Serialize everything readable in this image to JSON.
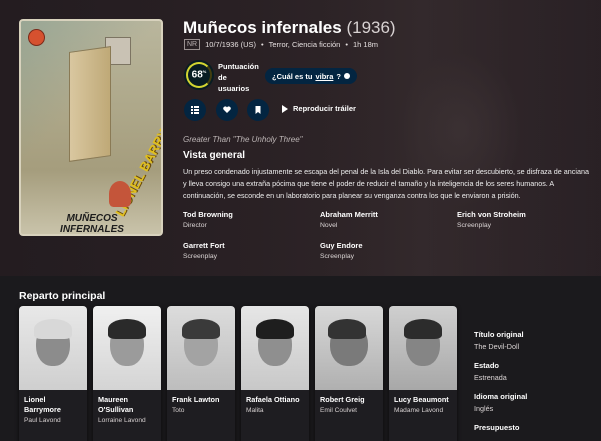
{
  "movie": {
    "title": "Muñecos infernales",
    "year": "(1936)",
    "certification": "NR",
    "release": "10/7/1936 (US)",
    "genres": "Terror, Ciencia ficción",
    "runtime": "1h 18m",
    "dot": "•"
  },
  "poster": {
    "actor_first": "LIONEL",
    "actor_last": "BARRYMORE",
    "caption_line1": "MUÑECOS",
    "caption_line2": "INFERNALES"
  },
  "score": {
    "value": "68",
    "unit": "%",
    "percent": 68,
    "label_line1": "Puntuación",
    "label_line2": "de",
    "label_line3": "usuarios",
    "ring_color": "#d2d531"
  },
  "vibe": {
    "prefix": "¿Cuál es tu ",
    "link": "vibra",
    "suffix": "?"
  },
  "actions": {
    "list_icon": "list-icon",
    "favorite_icon": "heart-icon",
    "watchlist_icon": "bookmark-icon",
    "play_label": "Reproducir tráiler"
  },
  "tagline": "Greater Than \"The Unholy Three\"",
  "overview": {
    "heading": "Vista general",
    "text": "Un preso condenado injustamente se escapa del penal de la Isla del Diablo. Para evitar ser descubierto, se disfraza de anciana y lleva consigo una extraña pócima que tiene el poder de reducir el tamaño y la inteligencia de los seres humanos. A continuación, se esconde en un laboratorio para planear su venganza contra los que le enviaron a prisión."
  },
  "crew": [
    {
      "name": "Tod Browning",
      "role": "Director"
    },
    {
      "name": "Abraham Merritt",
      "role": "Novel"
    },
    {
      "name": "Erich von Stroheim",
      "role": "Screenplay"
    },
    {
      "name": "Garrett Fort",
      "role": "Screenplay"
    },
    {
      "name": "Guy Endore",
      "role": "Screenplay"
    }
  ],
  "cast_heading": "Reparto principal",
  "cast": [
    {
      "name": "Lionel Barrymore",
      "role": "Paul Lavond"
    },
    {
      "name": "Maureen O'Sullivan",
      "role": "Lorraine Lavond"
    },
    {
      "name": "Frank Lawton",
      "role": "Toto"
    },
    {
      "name": "Rafaela Ottiano",
      "role": "Malita"
    },
    {
      "name": "Robert Greig",
      "role": "Emil Coulvet"
    },
    {
      "name": "Lucy Beaumont",
      "role": "Madame Lavond"
    }
  ],
  "side_facts": [
    {
      "key": "Título original",
      "value": "The Devil-Doll"
    },
    {
      "key": "Estado",
      "value": "Estrenada"
    },
    {
      "key": "Idioma original",
      "value": "Inglés"
    },
    {
      "key": "Presupuesto",
      "value": ""
    }
  ]
}
